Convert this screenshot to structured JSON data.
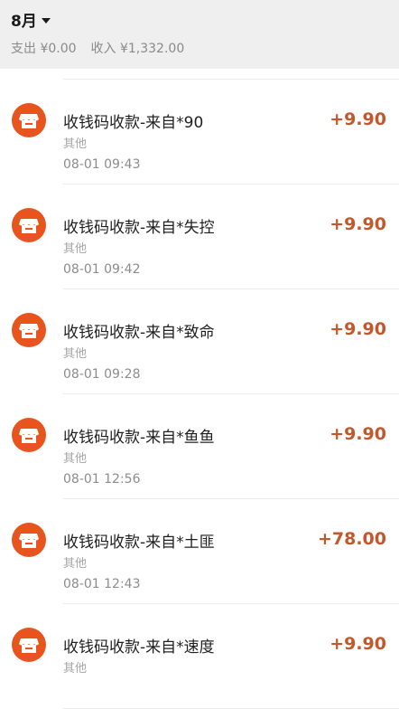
{
  "header": {
    "month": "8月",
    "expense_label": "支出 ¥0.00",
    "income_label": "收入 ¥1,332.00"
  },
  "accent_color": "#e8531e",
  "amount_color": "#c2582c",
  "transactions": [
    {
      "title": "收钱码收款-来自*90",
      "category": "其他",
      "time": "08-01 09:43",
      "amount": "+9.90",
      "icon": "store-icon"
    },
    {
      "title": "收钱码收款-来自*失控",
      "category": "其他",
      "time": "08-01 09:42",
      "amount": "+9.90",
      "icon": "store-icon"
    },
    {
      "title": "收钱码收款-来自*致命",
      "category": "其他",
      "time": "08-01 09:28",
      "amount": "+9.90",
      "icon": "store-icon"
    },
    {
      "title": "收钱码收款-来自*鱼鱼",
      "category": "其他",
      "time": "08-01 12:56",
      "amount": "+9.90",
      "icon": "store-icon"
    },
    {
      "title": "收钱码收款-来自*土匪",
      "category": "其他",
      "time": "08-01 12:43",
      "amount": "+78.00",
      "icon": "store-icon"
    },
    {
      "title": "收钱码收款-来自*速度",
      "category": "其他",
      "time": "",
      "amount": "+9.90",
      "icon": "store-icon"
    }
  ]
}
